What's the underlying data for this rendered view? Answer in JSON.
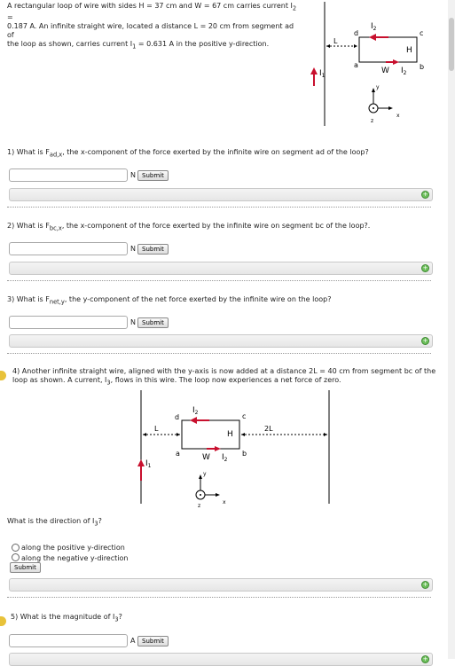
{
  "intro": {
    "line1": "A rectangular loop of wire with sides H = 37 cm and W = 67 cm carries current I",
    "line1_sub": "2",
    "line1_end": " =",
    "line2": "0.187 A. An infinite straight wire, located a distance L = 20 cm from segment ad of",
    "line3a": "the loop as shown, carries current I",
    "line3_sub": "1",
    "line3b": " = 0.631 A in the positive y-direction."
  },
  "diagram1": {
    "label_I2": "I",
    "label_I2_sub": "2",
    "label_d": "d",
    "label_c": "c",
    "label_a": "a",
    "label_b": "b",
    "label_L": "L",
    "label_H": "H",
    "label_W": "W",
    "label_I1": "I",
    "label_I1_sub": "1",
    "label_Ib": "I",
    "label_Ib_sub": "2",
    "axis_y": "y",
    "axis_z": "z",
    "axis_x": "x"
  },
  "q1": {
    "prefix": "1) What is F",
    "sub": "ad,x",
    "suffix": ", the x-component of the force exerted by the infinite wire on segment ad of the loop?",
    "unit": "N",
    "submit": "Submit"
  },
  "q2": {
    "prefix": "2) What is F",
    "sub": "bc,x",
    "suffix": ", the x-component of the force exerted by the infinite wire on segment bc of the loop?.",
    "unit": "N",
    "submit": "Submit"
  },
  "q3": {
    "prefix": "3) What is F",
    "sub": "net,y",
    "suffix": ", the y-component of the net force exerted by the infinite wire on the loop?",
    "unit": "N",
    "submit": "Submit"
  },
  "q4": {
    "line1": "4) Another infinite straight wire, aligned with the y-axis is now added at a distance 2L = 40 cm from segment bc of the",
    "line2a": "loop as shown. A current, I",
    "line2_sub": "3",
    "line2b": ", flows in this wire. The loop now experiences a net force of zero.",
    "question_a": "What is the direction of I",
    "question_sub": "3",
    "question_b": "?",
    "options": [
      "along the positive y-direction",
      "along the negative y-direction"
    ],
    "submit": "Submit"
  },
  "diagram2": {
    "label_I2": "I",
    "label_I2_sub": "2",
    "label_d": "d",
    "label_c": "c",
    "label_a": "a",
    "label_b": "b",
    "label_L": "L",
    "label_H": "H",
    "label_W": "W",
    "label_2L": "2L",
    "label_I1": "I",
    "label_I1_sub": "1",
    "label_Ib": "I",
    "label_Ib_sub": "2",
    "axis_y": "y",
    "axis_z": "z",
    "axis_x": "x"
  },
  "q5": {
    "prefix": "5) What is the magnitude of I",
    "sub": "3",
    "suffix": "?",
    "unit": "A",
    "submit": "Submit"
  },
  "colors": {
    "arrow": "#c8102e",
    "feedback_icon": "#6cbf5a",
    "marker": "#e8c23a"
  }
}
